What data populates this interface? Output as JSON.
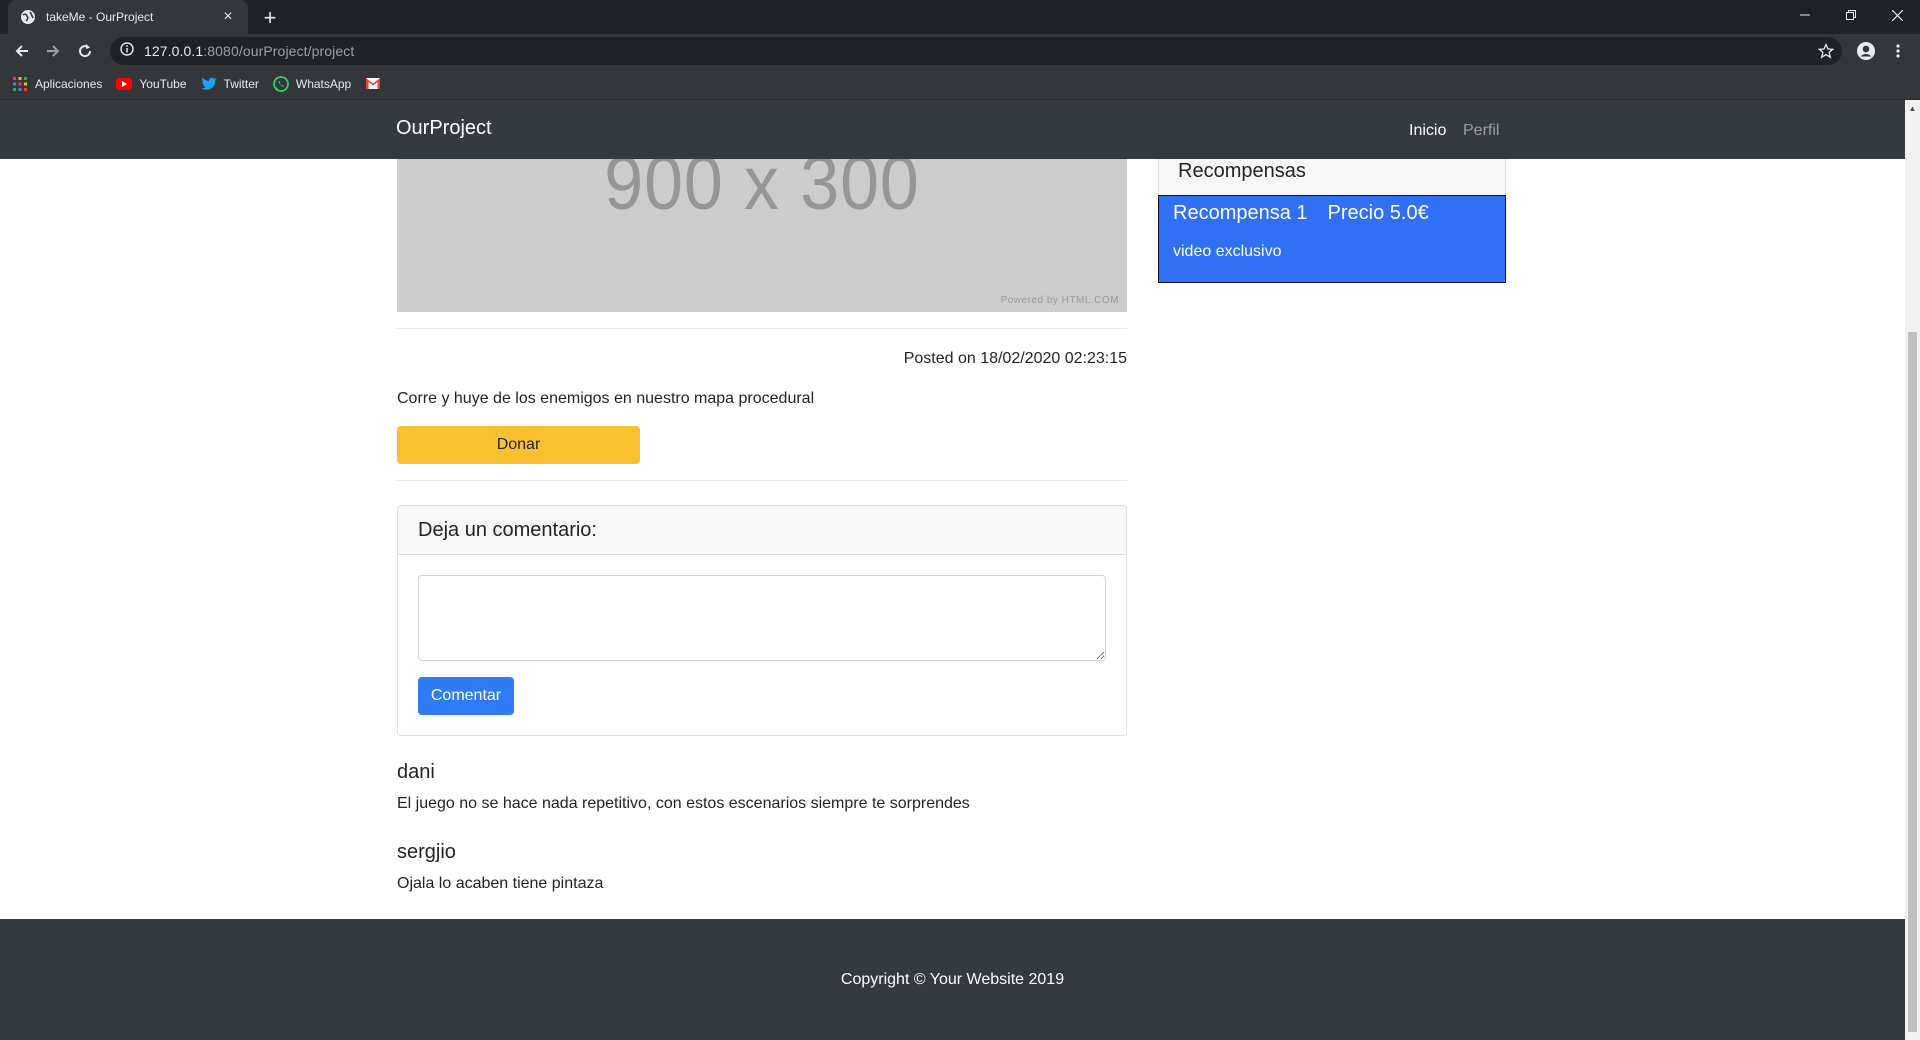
{
  "browser": {
    "tab_title": "takeMe - OurProject",
    "url_host": "127.0.0.1",
    "url_rest": ":8080/ourProject/project",
    "bookmarks": [
      {
        "label": "Aplicaciones",
        "icon": "apps-grid-icon"
      },
      {
        "label": "YouTube",
        "icon": "youtube-icon"
      },
      {
        "label": "Twitter",
        "icon": "twitter-icon"
      },
      {
        "label": "WhatsApp",
        "icon": "whatsapp-icon"
      },
      {
        "label": "",
        "icon": "gmail-icon"
      }
    ]
  },
  "navbar": {
    "brand": "OurProject",
    "links": [
      {
        "label": "Inicio",
        "active": true
      },
      {
        "label": "Perfil",
        "active": false
      }
    ]
  },
  "project": {
    "image_placeholder": "900 x 300",
    "image_powered": "Powered by HTML.COM",
    "posted": "Posted on 18/02/2020 02:23:15",
    "description": "Corre y huye de los enemigos en nuestro mapa procedural",
    "donate_label": "Donar"
  },
  "comment_form": {
    "title": "Deja un comentario:",
    "value": "",
    "button_label": "Comentar"
  },
  "comments": [
    {
      "author": "dani",
      "text": "El juego no se hace nada repetitivo, con estos escenarios siempre te sorprendes"
    },
    {
      "author": "sergjio",
      "text": "Ojala lo acaben tiene pintaza"
    }
  ],
  "rewards": {
    "title": "Recompensas",
    "items": [
      {
        "name": "Recompensa 1",
        "price": "Precio 5.0€",
        "description": "video exclusivo"
      }
    ]
  },
  "footer": {
    "copyright": "Copyright © Your Website 2019"
  },
  "colors": {
    "navbar_bg": "#343a40",
    "donate": "#fbc02d",
    "primary": "#2f7bf5",
    "reward_bg": "#2f70f5"
  }
}
